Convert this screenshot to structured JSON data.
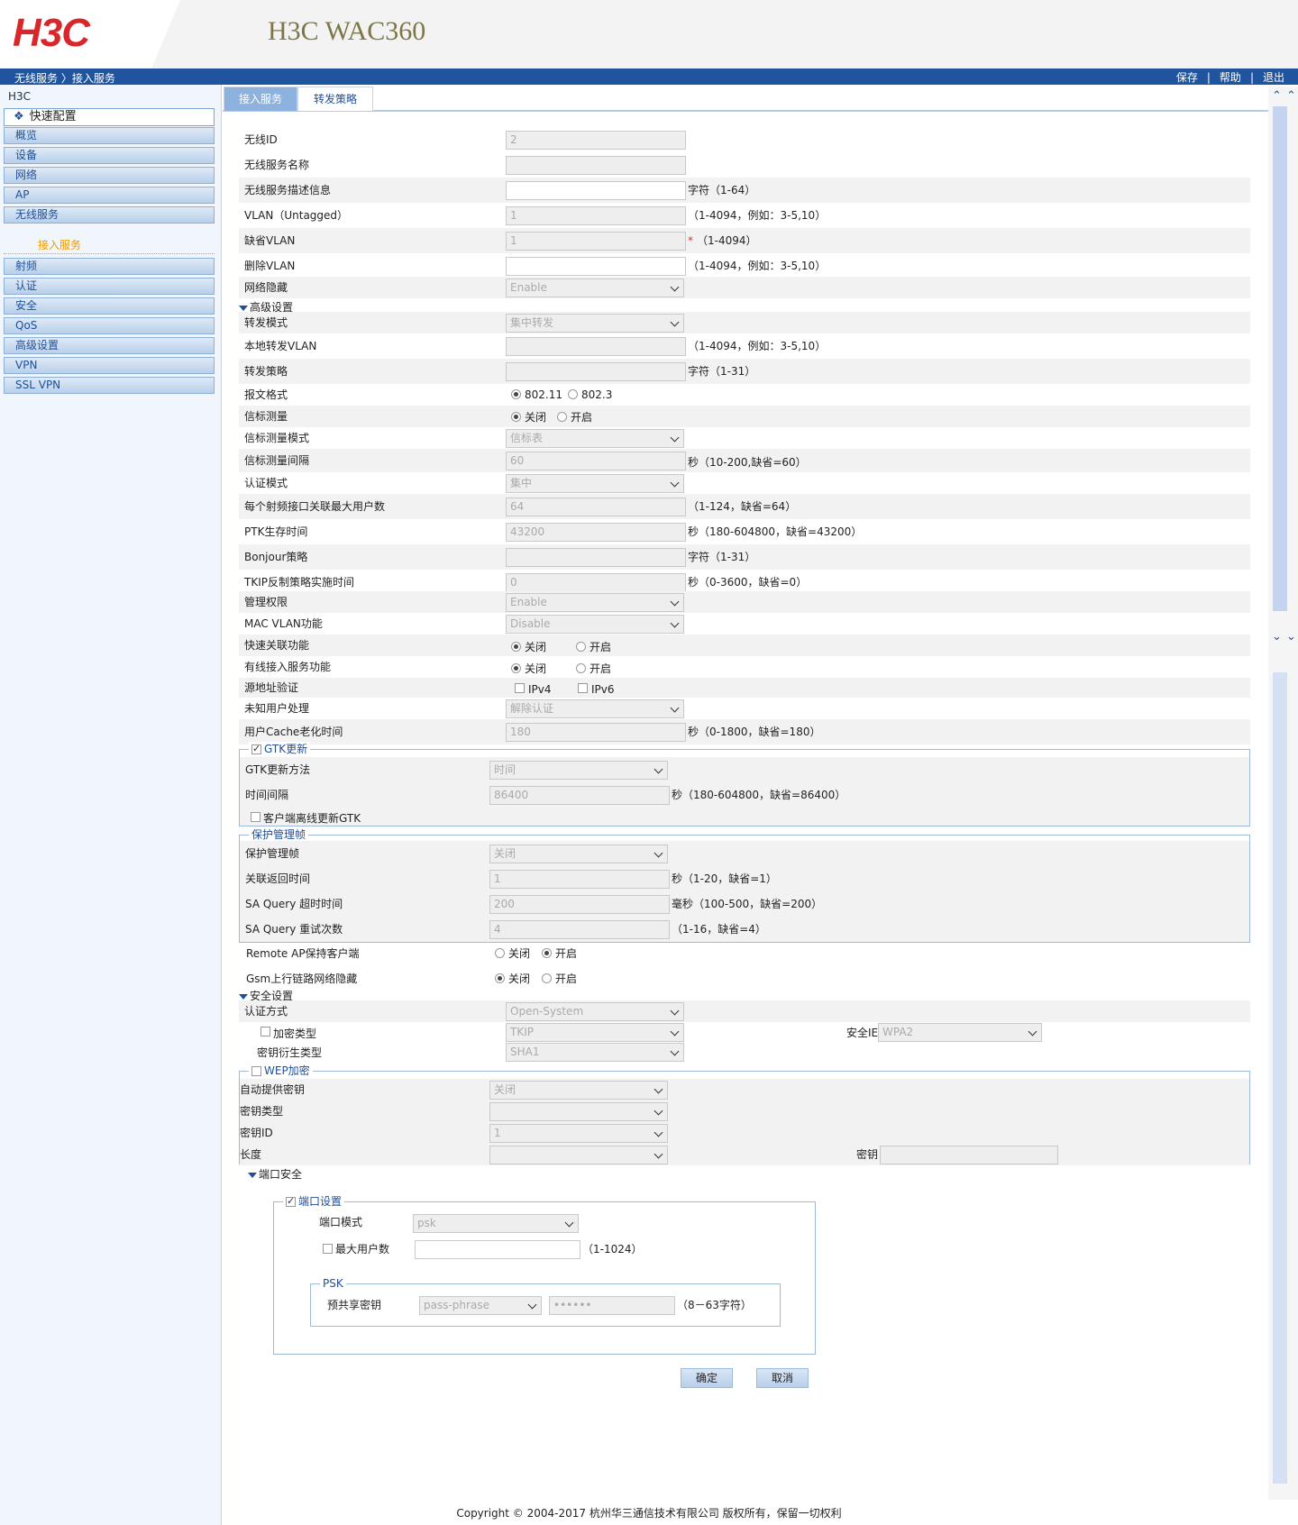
{
  "header": {
    "logo": "H3C",
    "product": "H3C WAC360"
  },
  "bar": {
    "crumb": "无线服务 〉接入服务",
    "save": "保存",
    "help": "帮助",
    "logout": "退出",
    "sep": "|"
  },
  "sidebar": {
    "root": "H3C",
    "quick": "快速配置",
    "quick_icon": "❖",
    "items": [
      "概览",
      "设备",
      "网络",
      "AP",
      "无线服务",
      "射频",
      "认证",
      "安全",
      "QoS",
      "高级设置",
      "VPN",
      "SSL VPN"
    ],
    "sub": "接入服务"
  },
  "tabs": [
    "接入服务",
    "转发策略"
  ],
  "form": {
    "basic": [
      {
        "label": "无线ID",
        "value": "2",
        "hint": ""
      },
      {
        "label": "无线服务名称",
        "value": "",
        "hint": ""
      },
      {
        "label": "无线服务描述信息",
        "value": "",
        "hint": "字符（1-64）"
      },
      {
        "label": "VLAN（Untagged）",
        "value": "1",
        "hint": "（1-4094，例如：3-5,10）"
      },
      {
        "label": "缺省VLAN",
        "value": "1",
        "hint": "（1-4094）",
        "req": "*"
      },
      {
        "label": "删除VLAN",
        "value": "",
        "hint": "（1-4094，例如：3-5,10）"
      },
      {
        "label": "网络隐藏",
        "value": "Enable",
        "hint": ""
      }
    ],
    "adv_title": "高级设置",
    "adv": [
      {
        "label": "转发模式",
        "value": "集中转发"
      },
      {
        "label": "本地转发VLAN",
        "value": "",
        "hint": "（1-4094，例如：3-5,10）"
      },
      {
        "label": "转发策略",
        "value": "",
        "hint": "字符（1-31）"
      },
      {
        "label": "报文格式",
        "r1": "802.11",
        "r2": "802.3"
      },
      {
        "label": "信标测量",
        "r1": "关闭",
        "r2": "开启"
      },
      {
        "label": "信标测量模式",
        "value": "信标表"
      },
      {
        "label": "信标测量间隔",
        "value": "60",
        "hint": "秒（10-200,缺省=60）"
      },
      {
        "label": "认证模式",
        "value": "集中"
      },
      {
        "label": "每个射频接口关联最大用户数",
        "value": "64",
        "hint": "（1-124，缺省=64）"
      },
      {
        "label": "PTK生存时间",
        "value": "43200",
        "hint": "秒（180-604800，缺省=43200）"
      },
      {
        "label": "Bonjour策略",
        "value": "",
        "hint": "字符（1-31）"
      },
      {
        "label": "TKIP反制策略实施时间",
        "value": "0",
        "hint": "秒（0-3600，缺省=0）"
      },
      {
        "label": "管理权限",
        "value": "Enable"
      },
      {
        "label": "MAC VLAN功能",
        "value": "Disable"
      },
      {
        "label": "快速关联功能",
        "r1": "关闭",
        "r2": "开启"
      },
      {
        "label": "有线接入服务功能",
        "r1": "关闭",
        "r2": "开启"
      },
      {
        "label": "源地址验证",
        "c1": "IPv4",
        "c2": "IPv6"
      },
      {
        "label": "未知用户处理",
        "value": "解除认证"
      },
      {
        "label": "用户Cache老化时间",
        "value": "180",
        "hint": "秒（0-1800，缺省=180）"
      }
    ],
    "gtk": {
      "legend": "GTK更新",
      "method_label": "GTK更新方法",
      "method": "时间",
      "interval_label": "时间间隔",
      "interval": "86400",
      "interval_hint": "秒（180-604800，缺省=86400）",
      "offline": "客户端离线更新GTK"
    },
    "pmf": {
      "legend": "保护管理帧",
      "rows": [
        {
          "label": "保护管理帧",
          "value": "关闭"
        },
        {
          "label": "关联返回时间",
          "value": "1",
          "hint": "秒（1-20，缺省=1）"
        },
        {
          "label": "SA Query 超时时间",
          "value": "200",
          "hint": "毫秒（100-500，缺省=200）"
        },
        {
          "label": "SA Query 重试次数",
          "value": "4",
          "hint": "（1-16，缺省=4）"
        }
      ]
    },
    "remote": {
      "label": "Remote AP保持客户端",
      "r1": "关闭",
      "r2": "开启"
    },
    "gsm": {
      "label": "Gsm上行链路网络隐藏",
      "r1": "关闭",
      "r2": "开启"
    },
    "sec_title": "安全设置",
    "auth_label": "认证方式",
    "auth": "Open-System",
    "enc_label": "加密类型",
    "enc": "TKIP",
    "secie_label": "安全IE",
    "secie": "WPA2",
    "kdf_label": "密钥衍生类型",
    "kdf": "SHA1",
    "wep": {
      "legend": "WEP加密",
      "auto_label": "自动提供密钥",
      "auto": "关闭",
      "type_label": "密钥类型",
      "type": "",
      "id_label": "密钥ID",
      "id": "1",
      "len_label": "长度",
      "len": "",
      "key_label": "密钥",
      "key": ""
    },
    "port_title": "端口安全",
    "port": {
      "legend": "端口设置",
      "mode_label": "端口模式",
      "mode": "psk",
      "max_label": "最大用户数",
      "max": "",
      "max_hint": "（1-1024）",
      "psk_legend": "PSK",
      "psk_label": "预共享密钥",
      "psk_type": "pass-phrase",
      "psk_value": "••••••",
      "psk_hint": "（8－63字符）"
    },
    "ok": "确定",
    "cancel": "取消"
  },
  "footer": "Copyright © 2004-2017 杭州华三通信技术有限公司 版权所有，保留一切权利"
}
